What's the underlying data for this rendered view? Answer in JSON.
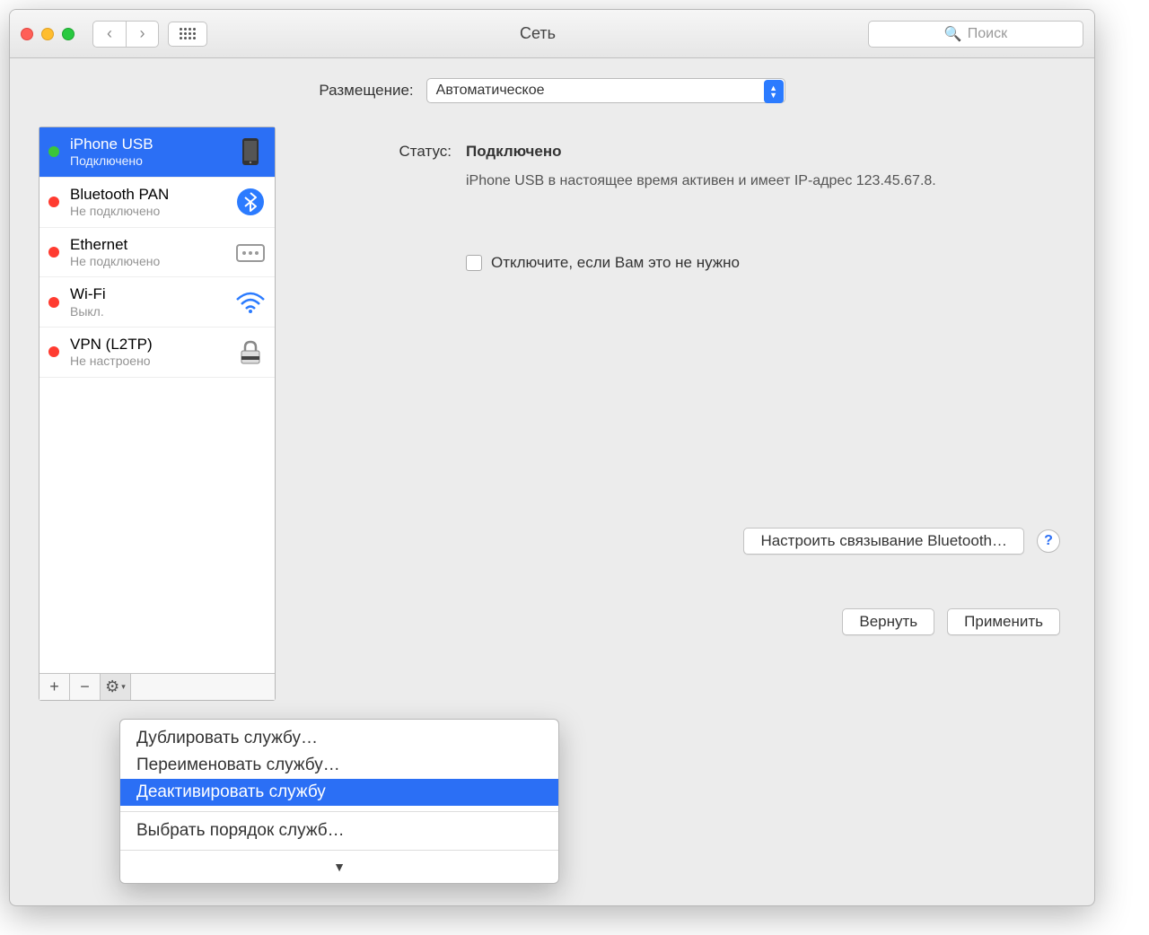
{
  "window": {
    "title": "Сеть"
  },
  "search": {
    "placeholder": "Поиск"
  },
  "location": {
    "label": "Размещение:",
    "value": "Автоматическое"
  },
  "services": [
    {
      "name": "iPhone USB",
      "status": "Подключено",
      "dot": "green",
      "selected": true,
      "icon": "phone"
    },
    {
      "name": "Bluetooth PAN",
      "status": "Не подключено",
      "dot": "red",
      "icon": "bluetooth"
    },
    {
      "name": "Ethernet",
      "status": "Не подключено",
      "dot": "red",
      "icon": "ethernet"
    },
    {
      "name": "Wi-Fi",
      "status": "Выкл.",
      "dot": "red",
      "icon": "wifi"
    },
    {
      "name": "VPN (L2TP)",
      "status": "Не настроено",
      "dot": "red",
      "icon": "lock"
    }
  ],
  "detail": {
    "status_label": "Статус:",
    "status_value": "Подключено",
    "status_desc": "iPhone USB  в настоящее время активен и имеет IP-адрес 123.45.67.8.",
    "checkbox_label": "Отключите, если Вам это не нужно"
  },
  "buttons": {
    "configure_bt": "Настроить связывание Bluetooth…",
    "revert": "Вернуть",
    "apply": "Применить"
  },
  "menu": {
    "items": [
      "Дублировать службу…",
      "Переименовать службу…",
      "Деактивировать службу"
    ],
    "after_sep": "Выбрать порядок служб…",
    "selected_index": 2
  }
}
